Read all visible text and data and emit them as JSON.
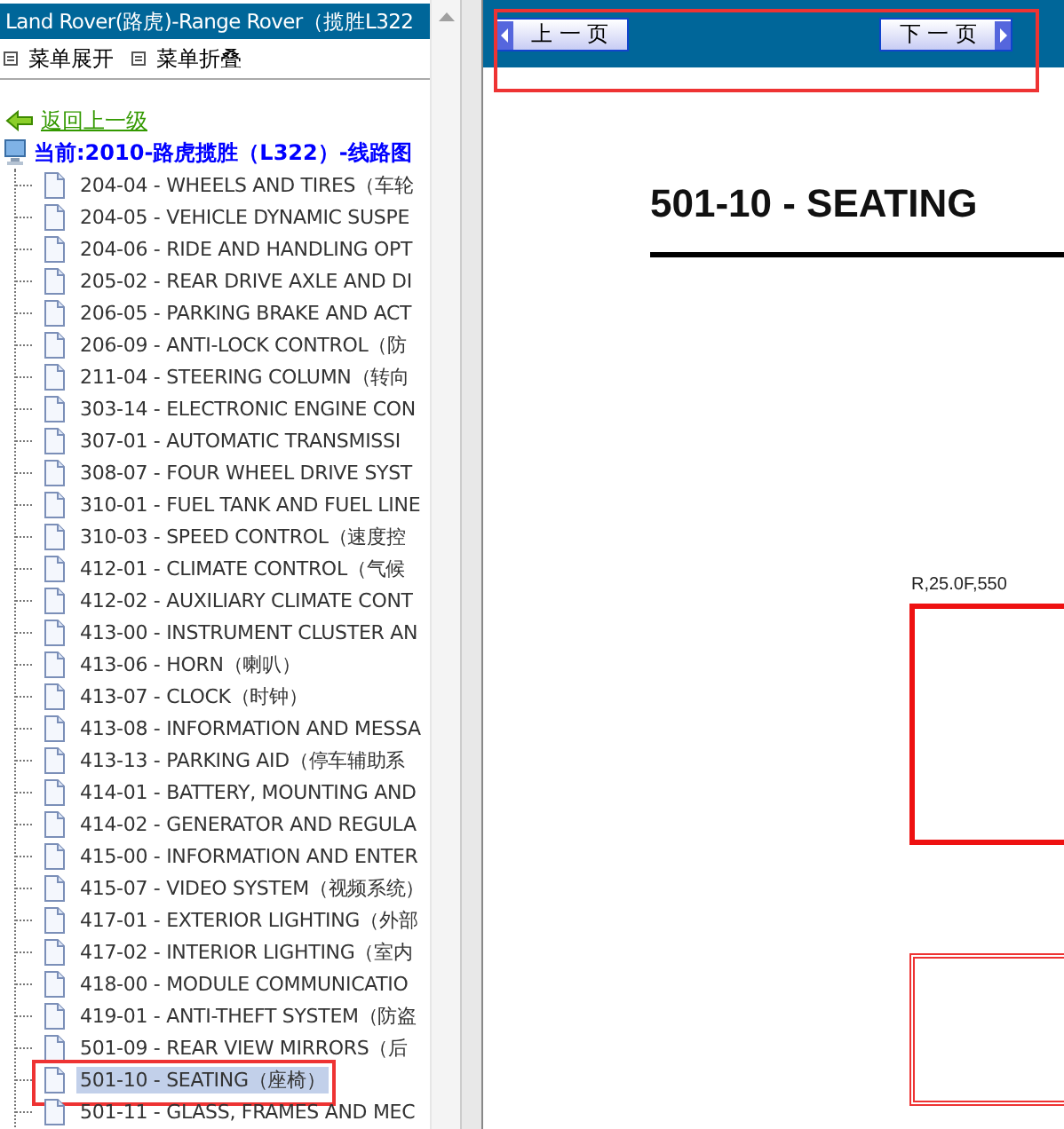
{
  "sidebar": {
    "title": "Land Rover(路虎)-Range Rover（揽胜L322",
    "menu_actions": [
      {
        "label": "菜单展开"
      },
      {
        "label": "菜单折叠"
      }
    ],
    "back_link": "返回上一级",
    "current": "当前:2010-路虎揽胜（L322）-线路图",
    "items": [
      {
        "label": "204-04 - WHEELS AND TIRES（车轮",
        "selected": false
      },
      {
        "label": "204-05 - VEHICLE DYNAMIC SUSPE",
        "selected": false
      },
      {
        "label": "204-06 - RIDE AND HANDLING OPT",
        "selected": false
      },
      {
        "label": "205-02 - REAR DRIVE AXLE AND DI",
        "selected": false
      },
      {
        "label": "206-05 - PARKING BRAKE AND ACT",
        "selected": false
      },
      {
        "label": "206-09 - ANTI-LOCK CONTROL（防",
        "selected": false
      },
      {
        "label": "211-04 - STEERING COLUMN（转向",
        "selected": false
      },
      {
        "label": "303-14 - ELECTRONIC ENGINE CON",
        "selected": false
      },
      {
        "label": "307-01 - AUTOMATIC TRANSMISSI",
        "selected": false
      },
      {
        "label": "308-07 - FOUR WHEEL DRIVE SYST",
        "selected": false
      },
      {
        "label": "310-01 - FUEL TANK AND FUEL LINE",
        "selected": false
      },
      {
        "label": "310-03 - SPEED CONTROL（速度控",
        "selected": false
      },
      {
        "label": "412-01 - CLIMATE CONTROL（气候",
        "selected": false
      },
      {
        "label": "412-02 - AUXILIARY CLIMATE CONT",
        "selected": false
      },
      {
        "label": "413-00 - INSTRUMENT CLUSTER AN",
        "selected": false
      },
      {
        "label": "413-06 - HORN（喇叭）",
        "selected": false
      },
      {
        "label": "413-07 - CLOCK（时钟）",
        "selected": false
      },
      {
        "label": "413-08 - INFORMATION AND MESSA",
        "selected": false
      },
      {
        "label": "413-13 - PARKING AID（停车辅助系",
        "selected": false
      },
      {
        "label": "414-01 - BATTERY, MOUNTING AND",
        "selected": false
      },
      {
        "label": "414-02 - GENERATOR AND REGULA",
        "selected": false
      },
      {
        "label": "415-00 - INFORMATION AND ENTER",
        "selected": false
      },
      {
        "label": "415-07 - VIDEO SYSTEM（视频系统）",
        "selected": false
      },
      {
        "label": "417-01 - EXTERIOR LIGHTING（外部",
        "selected": false
      },
      {
        "label": "417-02 - INTERIOR LIGHTING（室内",
        "selected": false
      },
      {
        "label": "418-00 - MODULE COMMUNICATIO",
        "selected": false
      },
      {
        "label": "419-01 - ANTI-THEFT SYSTEM（防盗",
        "selected": false
      },
      {
        "label": "501-09 - REAR VIEW MIRRORS（后",
        "selected": false
      },
      {
        "label": "501-10 - SEATING（座椅）",
        "selected": true
      },
      {
        "label": "501-11 - GLASS, FRAMES AND MEC",
        "selected": false
      }
    ]
  },
  "toolbar": {
    "prev_button": "上 一 页",
    "next_button": "下 一 页"
  },
  "document": {
    "heading": "501-10 - SEATING",
    "diagram_label": "R,25.0F,550"
  }
}
